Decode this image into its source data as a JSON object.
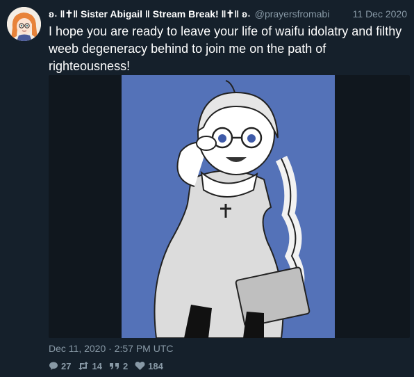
{
  "tweet": {
    "display_name": "ʚ˖ ‖✝‖ Sister Abigail ‖ Stream Break! ‖✝‖ ʚ˖",
    "handle": "@prayersfromabi",
    "date": "11 Dec 2020",
    "text": "I hope you are ready to leave your life of waifu idolatry and filthy weeb degeneracy behind to join me on the path of righteousness!",
    "timestamp": "Dec 11, 2020 · 2:57 PM UTC",
    "stats": {
      "replies": "27",
      "retweets": "14",
      "quotes": "2",
      "likes": "184"
    }
  },
  "icons": {
    "reply": "comment-icon",
    "retweet": "retweet-icon",
    "quote": "quote-icon",
    "like": "heart-icon"
  },
  "colors": {
    "background": "#15202b",
    "secondary_text": "#8899a6",
    "art_background": "#5472b8"
  }
}
